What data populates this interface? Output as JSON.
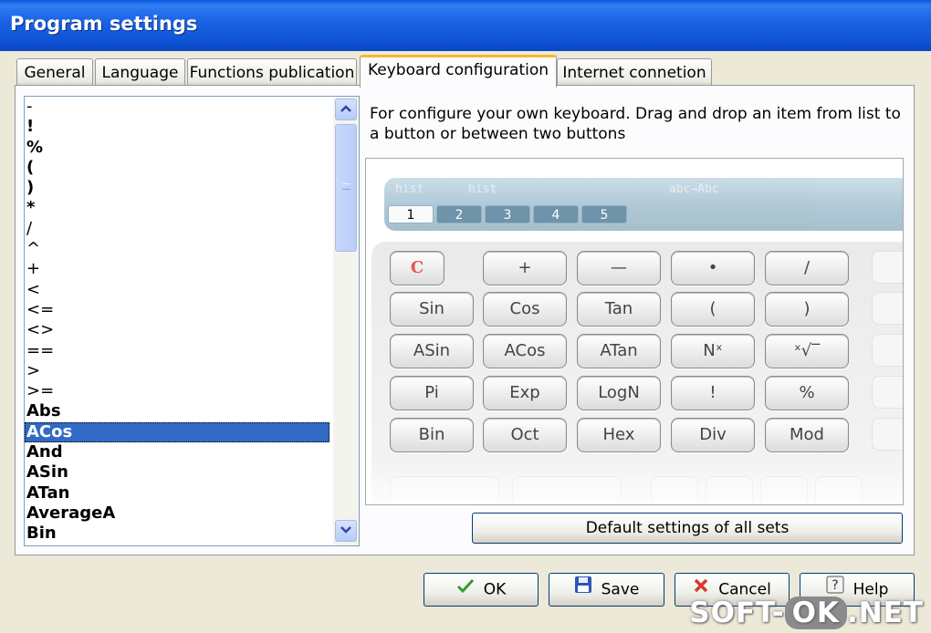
{
  "window": {
    "title": "Program settings"
  },
  "tabs": [
    {
      "label": "General"
    },
    {
      "label": "Language"
    },
    {
      "label": "Functions publication"
    },
    {
      "label": "Keyboard configuration",
      "active": true
    },
    {
      "label": "Internet connetion"
    }
  ],
  "function_list": {
    "items": [
      "-",
      "!",
      "%",
      "(",
      ")",
      "*",
      "/",
      "^",
      "+",
      "<",
      "<=",
      "<>",
      "==",
      ">",
      ">=",
      "Abs",
      "ACos",
      "And",
      "ASin",
      "ATan",
      "AverageA",
      "Bin"
    ],
    "selected": "ACos"
  },
  "instructions": "For configure your own keyboard. Drag and drop an item from list to a button or between two buttons",
  "calculator": {
    "top_labels": [
      "hist",
      "hist",
      "abc→Abc"
    ],
    "sets": [
      "1",
      "2",
      "3",
      "4",
      "5"
    ],
    "active_set": "1",
    "clear_key": "C",
    "rows": [
      [
        "+",
        "—",
        "•",
        "/"
      ],
      [
        "Sin",
        "Cos",
        "Tan",
        "(",
        ")"
      ],
      [
        "ASin",
        "ACos",
        "ATan",
        "Nˣ",
        "ˣ√‾"
      ],
      [
        "Pi",
        "Exp",
        "LogN",
        "!",
        "%"
      ],
      [
        "Bin",
        "Oct",
        "Hex",
        "Div",
        "Mod"
      ]
    ]
  },
  "default_button": "Default settings of all sets",
  "footer_buttons": {
    "ok": "OK",
    "save": "Save",
    "cancel": "Cancel",
    "help": "Help"
  },
  "watermark": {
    "pre": "SOFT-",
    "box": "OK",
    "post": ".NET"
  }
}
